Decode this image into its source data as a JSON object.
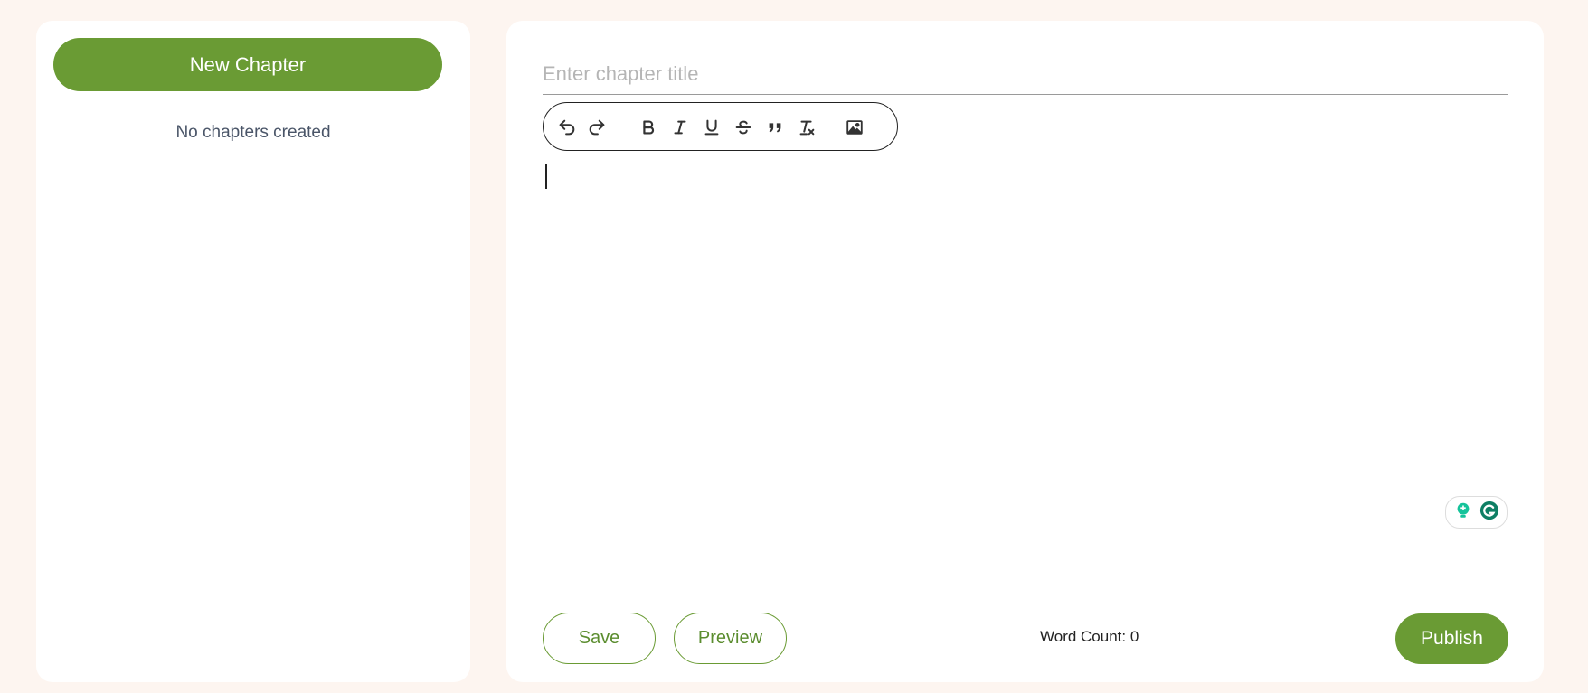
{
  "sidebar": {
    "new_chapter_label": "New Chapter",
    "empty_message": "No chapters created"
  },
  "editor": {
    "title_placeholder": "Enter chapter title",
    "title_value": "",
    "toolbar": {
      "tools": [
        "undo-icon",
        "redo-icon",
        "bold-icon",
        "italic-icon",
        "underline-icon",
        "strikethrough-icon",
        "blockquote-icon",
        "clear-format-icon",
        "image-icon"
      ]
    },
    "content": ""
  },
  "footer": {
    "save_label": "Save",
    "preview_label": "Preview",
    "word_count_label": "Word Count: 0",
    "publish_label": "Publish"
  },
  "colors": {
    "background": "#fdf5f0",
    "accent": "#6a9b34",
    "panel": "#ffffff"
  }
}
